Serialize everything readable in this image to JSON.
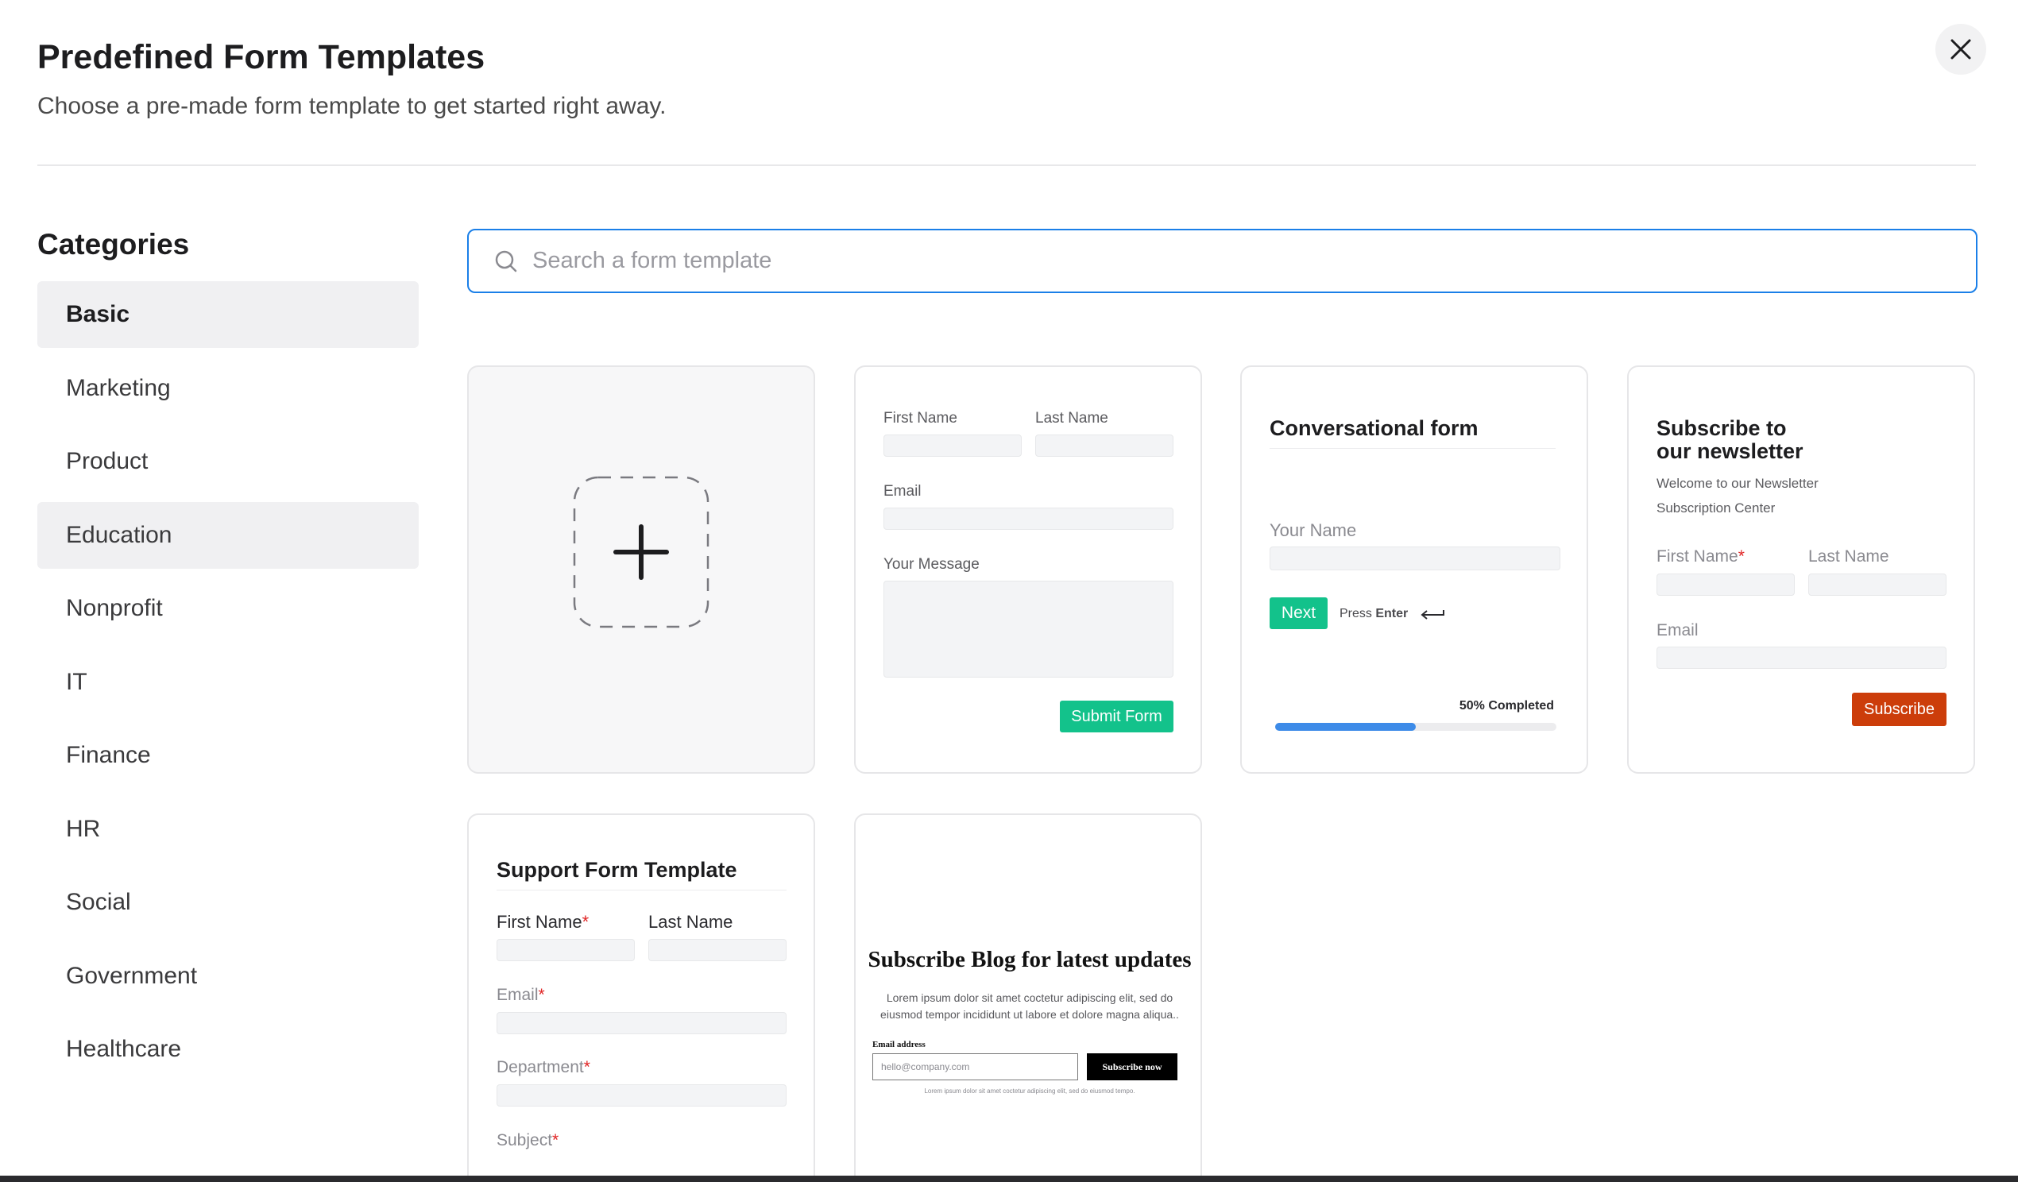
{
  "header": {
    "title": "Predefined Form Templates",
    "subtitle": "Choose a pre-made form template to get started right away."
  },
  "sidebar": {
    "title": "Categories",
    "items": [
      {
        "label": "Basic",
        "state": "active"
      },
      {
        "label": "Marketing",
        "state": ""
      },
      {
        "label": "Product",
        "state": ""
      },
      {
        "label": "Education",
        "state": "hover"
      },
      {
        "label": "Nonprofit",
        "state": ""
      },
      {
        "label": "IT",
        "state": ""
      },
      {
        "label": "Finance",
        "state": ""
      },
      {
        "label": "HR",
        "state": ""
      },
      {
        "label": "Social",
        "state": ""
      },
      {
        "label": "Government",
        "state": ""
      },
      {
        "label": "Healthcare",
        "state": ""
      }
    ]
  },
  "search": {
    "placeholder": "Search a form template",
    "value": ""
  },
  "templates": {
    "contact": {
      "first_name": "First Name",
      "last_name": "Last Name",
      "email": "Email",
      "message": "Your Message",
      "submit": "Submit Form"
    },
    "conversational": {
      "title": "Conversational form",
      "your_name": "Your Name",
      "next": "Next",
      "press": "Press",
      "enter": "Enter",
      "progress_label": "50% Completed",
      "progress": 0.5
    },
    "newsletter": {
      "title_line1": "Subscribe to",
      "title_line2": "our newsletter",
      "desc_line1": "Welcome to our Newsletter",
      "desc_line2": "Subscription Center",
      "first_name": "First Name",
      "last_name": "Last Name",
      "email": "Email",
      "subscribe": "Subscribe"
    },
    "support": {
      "title": "Support Form Template",
      "first_name": "First Name",
      "last_name": "Last Name",
      "email": "Email",
      "department": "Department",
      "subject": "Subject",
      "required_mark": "*"
    },
    "blog": {
      "title": "Subscribe Blog for latest updates",
      "body_line1": "Lorem ipsum dolor sit amet coctetur adipiscing elit, sed do",
      "body_line2": "eiusmod tempor incididunt ut labore et dolore magna aliqua..",
      "email_label": "Email address",
      "email_placeholder": "hello@company.com",
      "button": "Subscribe now",
      "footnote": "Lorem ipsum dolor sit amet coctetur adipiscing elit, sed do eiusmod tempo."
    }
  },
  "colors": {
    "accent_blue": "#1a7fe8",
    "green": "#13c28b",
    "orange": "#cc3d0a",
    "required_red": "#e02424"
  },
  "icons": {
    "close": "close-icon",
    "search": "search-icon",
    "plus": "plus-icon",
    "enter": "enter-arrow-icon"
  }
}
